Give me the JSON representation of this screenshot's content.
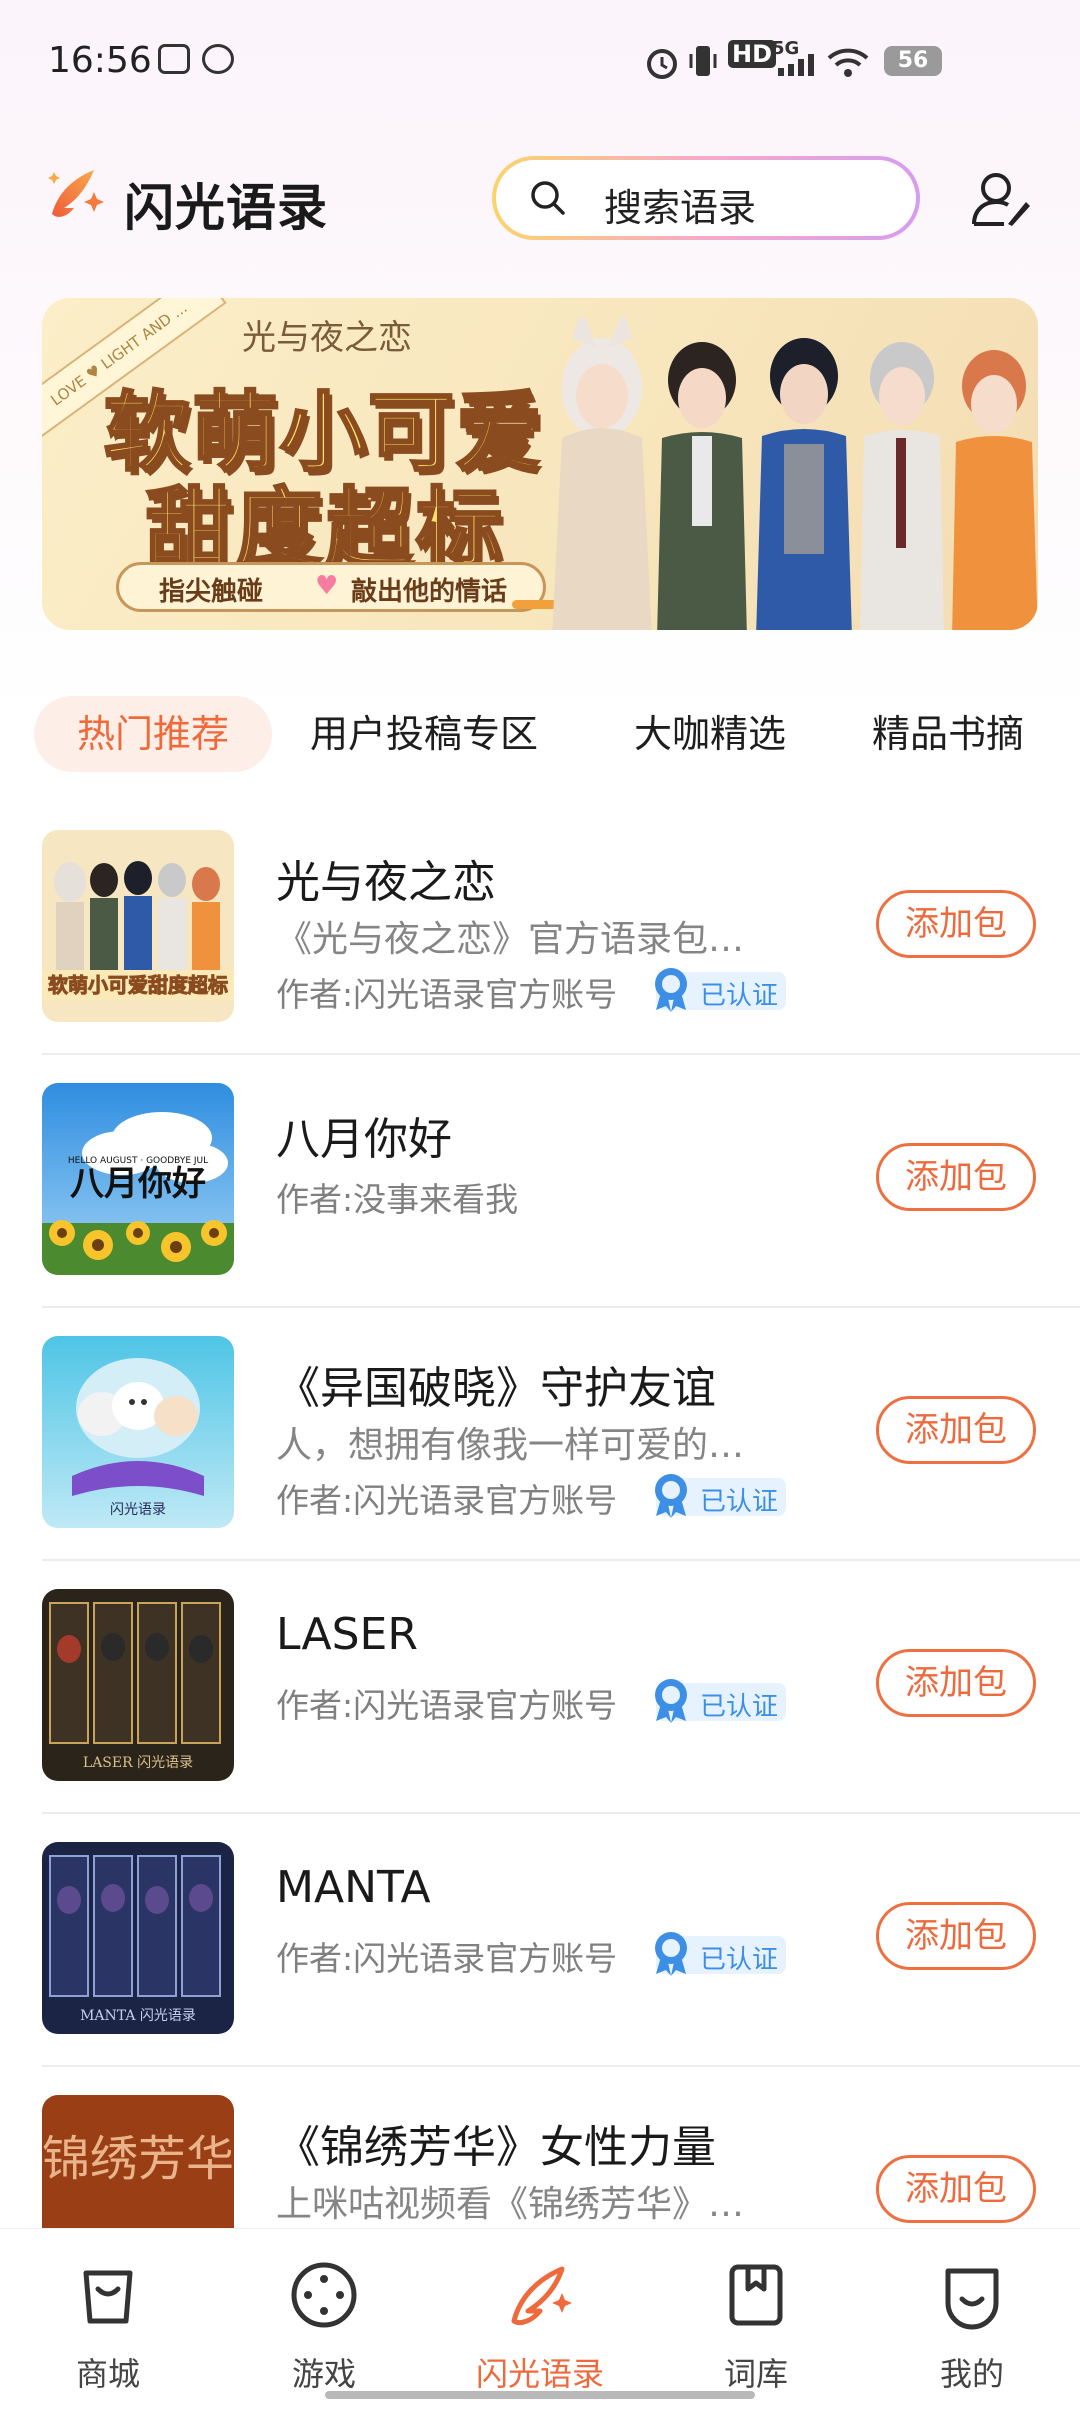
{
  "status_bar": {
    "time": "16:56",
    "network": "5G",
    "hd": "HD",
    "battery": "56"
  },
  "header": {
    "app_title": "闪光语录",
    "search_placeholder": "搜索语录"
  },
  "banner": {
    "ribbon_text": "LOVE ♥ LIGHT AND ...",
    "logo_text": "光与夜之恋",
    "headline_1": "软萌小可爱",
    "headline_2": "甜度超标",
    "tagline_left": "指尖触碰",
    "tagline_right": "敲出他的情话"
  },
  "tabs": [
    "热门推荐",
    "用户投稿专区",
    "大咖精选",
    "精品书摘"
  ],
  "items": [
    {
      "title": "光与夜之恋",
      "desc": "《光与夜之恋》官方语录包…",
      "author": "作者:闪光语录官方账号",
      "verified": "已认证",
      "button": "添加包"
    },
    {
      "title": "八月你好",
      "desc": "",
      "author": "作者:没事来看我",
      "verified": "",
      "button": "添加包"
    },
    {
      "title": "《异国破晓》守护友谊",
      "desc": "人，想拥有像我一样可爱的…",
      "author": "作者:闪光语录官方账号",
      "verified": "已认证",
      "button": "添加包"
    },
    {
      "title": "LASER",
      "desc": "",
      "author": "作者:闪光语录官方账号",
      "verified": "已认证",
      "button": "添加包"
    },
    {
      "title": "MANTA",
      "desc": "",
      "author": "作者:闪光语录官方账号",
      "verified": "已认证",
      "button": "添加包"
    },
    {
      "title": "《锦绣芳华》女性力量",
      "desc": "上咪咕视频看《锦绣芳华》…",
      "author": "",
      "verified": "",
      "button": "添加包"
    }
  ],
  "thumb_text": {
    "august": "八月你好",
    "august_small": "HELLO AUGUST · GOODBYE JUL",
    "laser": "LASER 闪光语录",
    "manta": "MANTA 闪光语录",
    "jinxiu": "锦绣芳华"
  },
  "bottom_nav": [
    "商城",
    "游戏",
    "闪光语录",
    "词库",
    "我的"
  ],
  "colors": {
    "accent": "#ee6a3c",
    "verified_blue": "#3d8fe6"
  }
}
